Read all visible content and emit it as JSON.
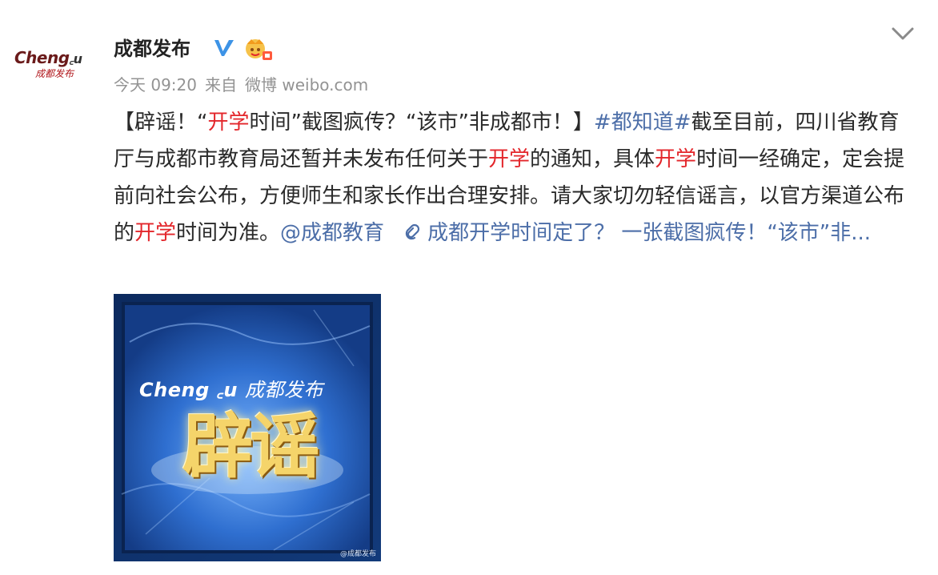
{
  "avatar": {
    "brand_text": "Cheng",
    "brand_dots": "꜀u",
    "brand_tail": "u",
    "sub_text": "成都发布"
  },
  "user": {
    "name": "成都发布"
  },
  "meta": {
    "time": "今天 09:20",
    "source_prefix": "来自",
    "source": "微博 weibo.com"
  },
  "post": {
    "p1": "【辟谣！“",
    "p2": "开学",
    "p3": "时间”截图疯传？“该市”非成都市！】",
    "hashtag": "#都知道#",
    "p4": "截至目前，四川省教育厅与成都市教育局还暂并未发布任何关于",
    "p5": "开学",
    "p6": "的通知，具体",
    "p7": "开学",
    "p8": "时间一经确定，定会提前向社会公布，方便师生和家长作出合理安排。请大家切勿轻信谣言，以官方渠道公布的",
    "p9": "开学",
    "p10": "时间为准。",
    "mention": "@成都教育",
    "link_text": "成都开学时间定了？ 一张截图疯传！“该市”非..."
  },
  "image": {
    "banner_latin": "Cheng",
    "banner_mid": " ꜀u ",
    "banner_cn": "成都发布",
    "big_text": "辟谣",
    "watermark": "@成都发布"
  },
  "colors": {
    "red": "#e3262b",
    "link_blue": "#4c6ea8",
    "meta_gray": "#939393",
    "verified_blue": "#3d93e6"
  }
}
